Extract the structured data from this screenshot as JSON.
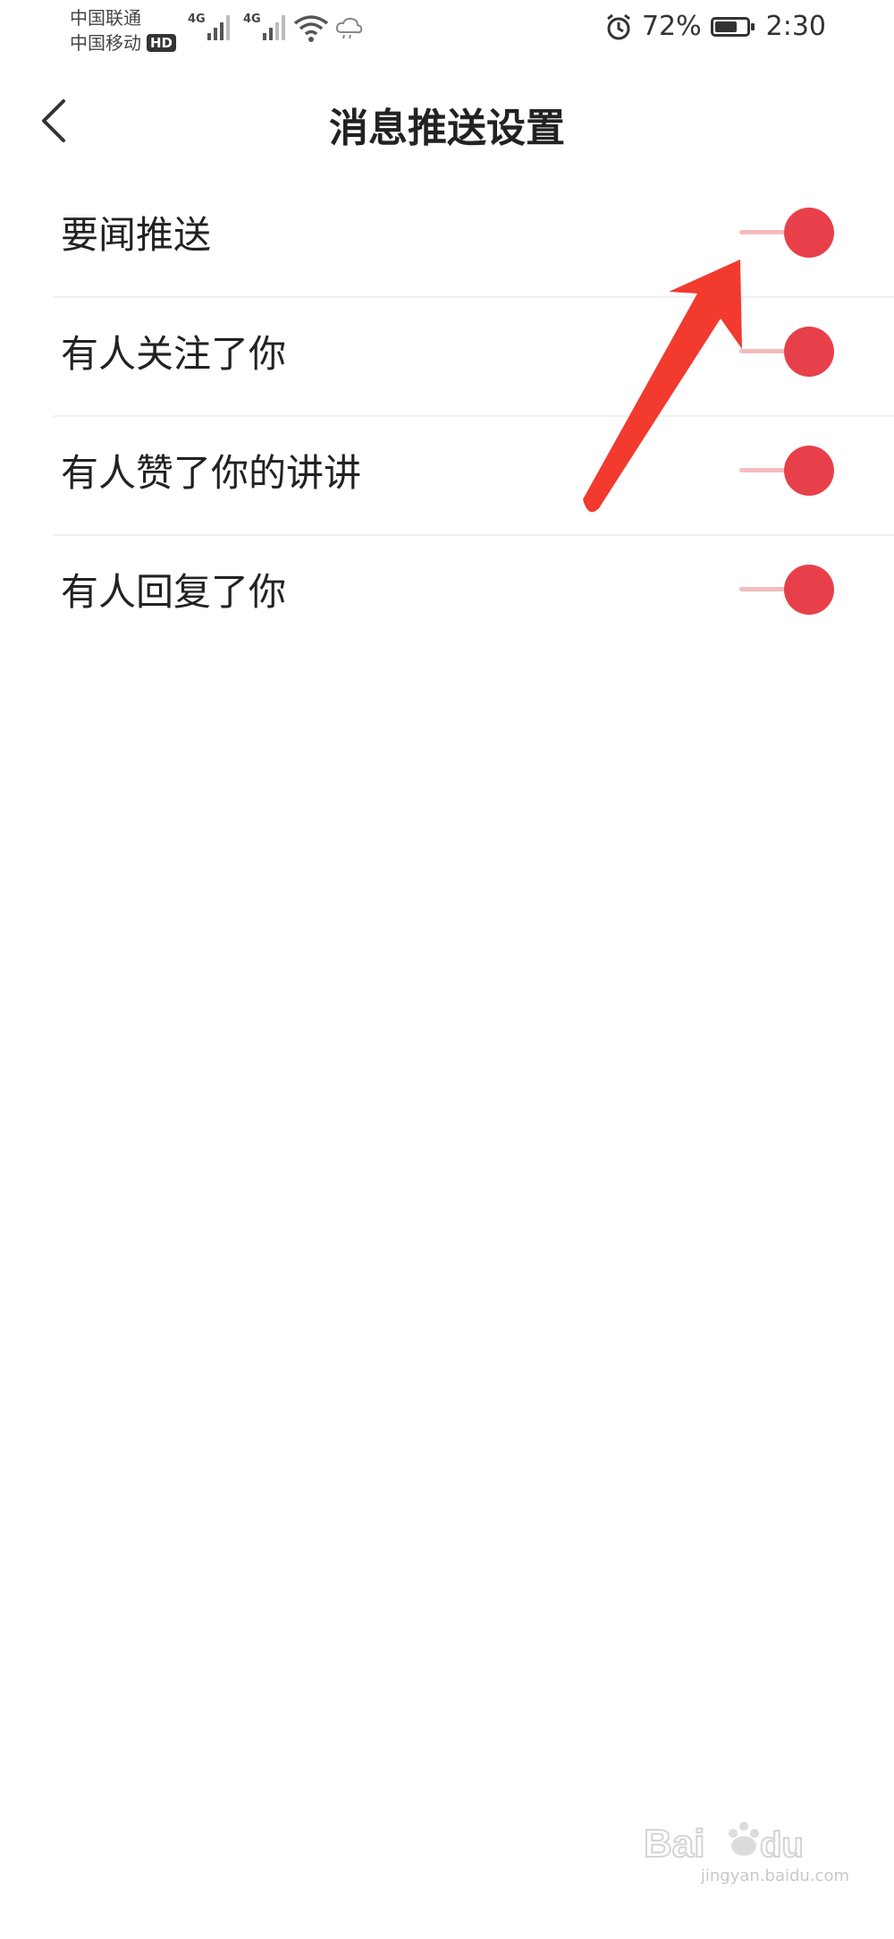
{
  "status_bar": {
    "carrier1": "中国联通",
    "carrier2": "中国移动",
    "hd": "HD",
    "net1": "4G",
    "net2": "4G",
    "battery_percent": "72%",
    "battery_level": 0.72,
    "time": "2:30",
    "icons": [
      "signal-icon",
      "wifi-icon",
      "cloud-icon",
      "alarm-icon",
      "battery-icon"
    ]
  },
  "header": {
    "title": "消息推送设置",
    "back_icon": "chevron-left-icon"
  },
  "settings": [
    {
      "label": "要闻推送",
      "enabled": true
    },
    {
      "label": "有人关注了你",
      "enabled": true
    },
    {
      "label": "有人赞了你的讲讲",
      "enabled": true
    },
    {
      "label": "有人回复了你",
      "enabled": true
    }
  ],
  "colors": {
    "toggle_on": "#e8404a",
    "toggle_track": "#f4bcbc",
    "annotation": "#f23a2f"
  },
  "watermark": {
    "logo_text": "Baidu经验",
    "url": "jingyan.baidu.com"
  }
}
